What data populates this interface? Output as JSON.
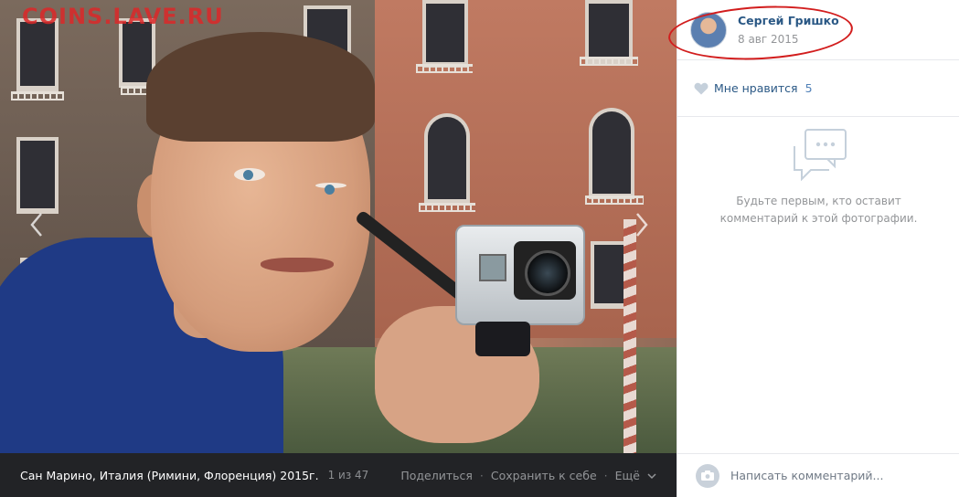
{
  "watermark": "COINS.LAVE.RU",
  "photo": {
    "prev_icon": "chevron-left-icon",
    "next_icon": "chevron-right-icon"
  },
  "bottom_bar": {
    "album_title": "Сан Марино, Италия (Римини, Флоренция) 2015г.",
    "counter": "1 из 47",
    "share_label": "Поделиться",
    "save_label": "Сохранить к себе",
    "more_label": "Ещё",
    "separator": "·"
  },
  "author": {
    "name": "Сергей Гришко",
    "date": "8 авг 2015"
  },
  "likes": {
    "label": "Мне нравится",
    "count": "5",
    "icon": "heart-icon"
  },
  "comments": {
    "empty_line1": "Будьте первым, кто оставит",
    "empty_line2": "комментарий к этой фотографии.",
    "placeholder": "Написать комментарий...",
    "icon": "camera-icon"
  },
  "colors": {
    "link": "#2a5885",
    "muted": "#939598",
    "bar_bg": "#222326",
    "annotation": "#d21d1d"
  }
}
